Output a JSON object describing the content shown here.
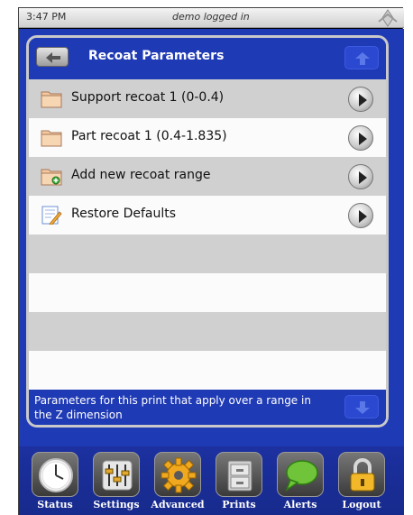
{
  "status_bar": {
    "time": "3:47 PM",
    "user_text": "demo logged in",
    "logo_icon": "brand-logo-icon"
  },
  "panel": {
    "title": "Recoat Parameters",
    "back_icon": "back-arrow-icon",
    "scroll_up_icon": "up-arrow-icon",
    "scroll_down_icon": "down-arrow-icon",
    "footer_text": "Parameters for this print that apply over a range in the Z dimension",
    "items": [
      {
        "label": "Support recoat 1 (0-0.4)",
        "icon": "folder-icon"
      },
      {
        "label": "Part recoat 1 (0.4-1.835)",
        "icon": "folder-icon"
      },
      {
        "label": "Add new recoat range",
        "icon": "folder-add-icon"
      },
      {
        "label": "Restore Defaults",
        "icon": "notepad-edit-icon"
      }
    ]
  },
  "nav": {
    "items": [
      {
        "label": "Status",
        "icon": "clock-icon"
      },
      {
        "label": "Settings",
        "icon": "sliders-icon"
      },
      {
        "label": "Advanced",
        "icon": "gear-icon"
      },
      {
        "label": "Prints",
        "icon": "file-cabinet-icon"
      },
      {
        "label": "Alerts",
        "icon": "speech-bubble-icon"
      },
      {
        "label": "Logout",
        "icon": "padlock-icon"
      }
    ]
  },
  "colors": {
    "panel_blue": "#1f3ab5",
    "row_gray": "#d0d0d0",
    "row_white": "#fbfbfb",
    "status_bar": "#e0e0e0"
  }
}
